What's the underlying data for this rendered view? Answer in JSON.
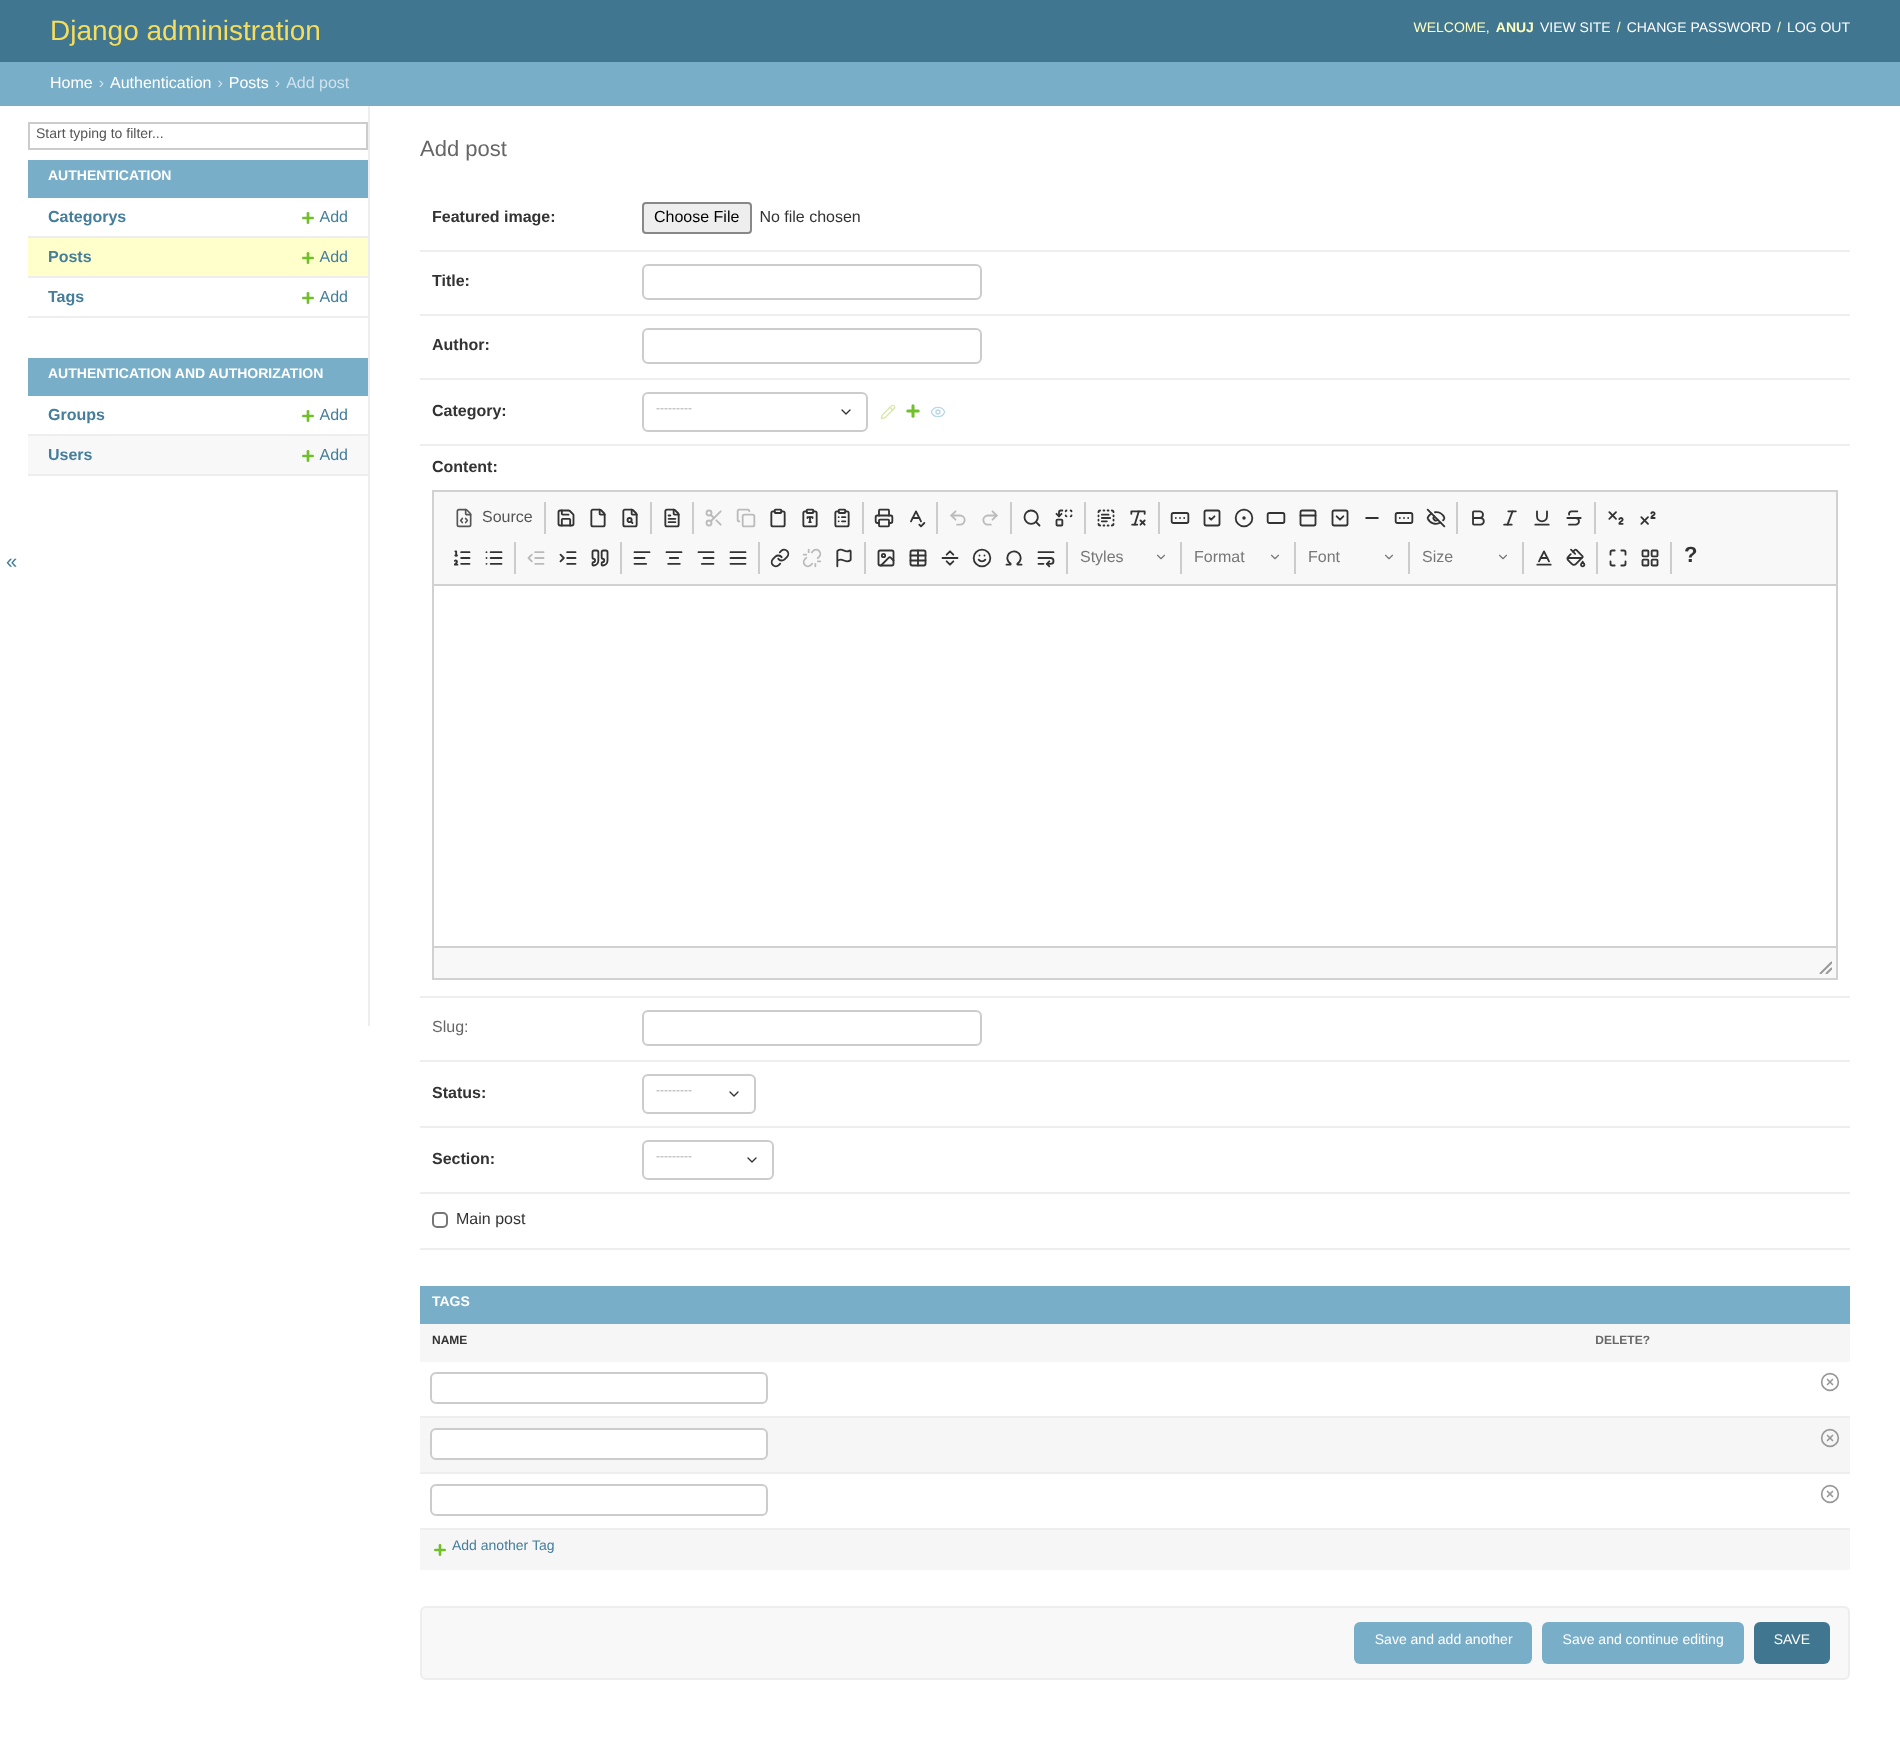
{
  "header": {
    "title": "Django administration",
    "welcome": "WELCOME,",
    "user": "ANUJ",
    "links": [
      "VIEW SITE",
      "CHANGE PASSWORD",
      "LOG OUT"
    ],
    "separator": "/"
  },
  "breadcrumbs": {
    "items": [
      "Home",
      "Authentication",
      "Posts"
    ],
    "current": "Add post",
    "separator": "›"
  },
  "sidebar": {
    "filter_placeholder": "Start typing to filter...",
    "toggle": "«",
    "modules": [
      {
        "caption": "AUTHENTICATION",
        "models": [
          {
            "name": "Categorys",
            "add": "Add",
            "selected": false
          },
          {
            "name": "Posts",
            "add": "Add",
            "selected": true
          },
          {
            "name": "Tags",
            "add": "Add",
            "selected": false
          }
        ]
      },
      {
        "caption": "AUTHENTICATION AND AUTHORIZATION",
        "models": [
          {
            "name": "Groups",
            "add": "Add",
            "selected": false
          },
          {
            "name": "Users",
            "add": "Add",
            "selected": false
          }
        ]
      }
    ]
  },
  "page_title": "Add post",
  "fields": [
    {
      "kind": "file",
      "label": "Featured image:",
      "required": true,
      "button": "Choose File",
      "status": "No file chosen"
    },
    {
      "kind": "text",
      "label": "Title:",
      "required": true
    },
    {
      "kind": "text",
      "label": "Author:",
      "required": true
    },
    {
      "kind": "select",
      "label": "Category:",
      "required": true,
      "value": "---------",
      "related_actions": true
    },
    {
      "kind": "editor",
      "label": "Content:",
      "required": true
    },
    {
      "kind": "text",
      "label": "Slug:",
      "required": false
    },
    {
      "kind": "select",
      "label": "Status:",
      "required": true,
      "value": "---------",
      "related_actions": false
    },
    {
      "kind": "select",
      "label": "Section:",
      "required": true,
      "value": "---------",
      "related_actions": false
    },
    {
      "kind": "checkbox",
      "label": "Main post",
      "checked": false
    }
  ],
  "editor": {
    "source": "Source",
    "combos": [
      "Styles",
      "Format",
      "Font",
      "Size"
    ],
    "help": "?"
  },
  "inline": {
    "title": "TAGS",
    "columns": [
      "NAME",
      "DELETE?"
    ],
    "rows": [
      {
        "kind": "input"
      },
      {
        "kind": "input"
      },
      {
        "kind": "input"
      }
    ],
    "add_link": "Add another Tag"
  },
  "submit": [
    {
      "label": "Save and add another",
      "kind": "secondary"
    },
    {
      "label": "Save and continue editing",
      "kind": "secondary"
    },
    {
      "label": "SAVE",
      "kind": "primary"
    }
  ]
}
